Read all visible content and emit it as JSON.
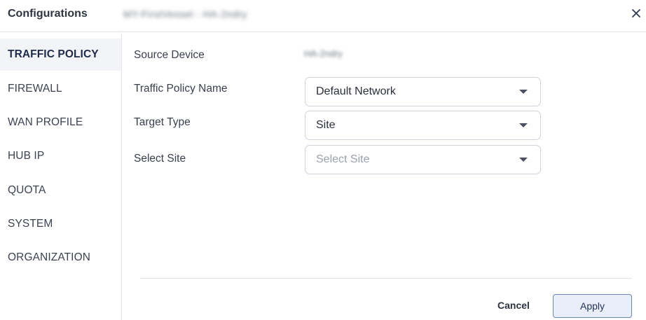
{
  "header": {
    "title": "Configurations",
    "device_name": "MY-FirstVessel - HA-2ndry"
  },
  "sidebar": {
    "items": [
      {
        "label": "TRAFFIC POLICY",
        "active": true
      },
      {
        "label": "FIREWALL"
      },
      {
        "label": "WAN PROFILE"
      },
      {
        "label": "HUB IP"
      },
      {
        "label": "QUOTA"
      },
      {
        "label": "SYSTEM"
      },
      {
        "label": "ORGANIZATION"
      }
    ]
  },
  "form": {
    "source_device_label": "Source Device",
    "source_device_value": "HA-2ndry",
    "policy_name_label": "Traffic Policy Name",
    "policy_name_value": "Default Network",
    "target_type_label": "Target Type",
    "target_type_value": "Site",
    "select_site_label": "Select Site",
    "select_site_placeholder": "Select Site"
  },
  "footer": {
    "cancel_label": "Cancel",
    "apply_label": "Apply"
  },
  "colors": {
    "active_bg": "#f3f4f8",
    "apply_border": "#6b86b8",
    "apply_bg": "#e9eef8"
  }
}
